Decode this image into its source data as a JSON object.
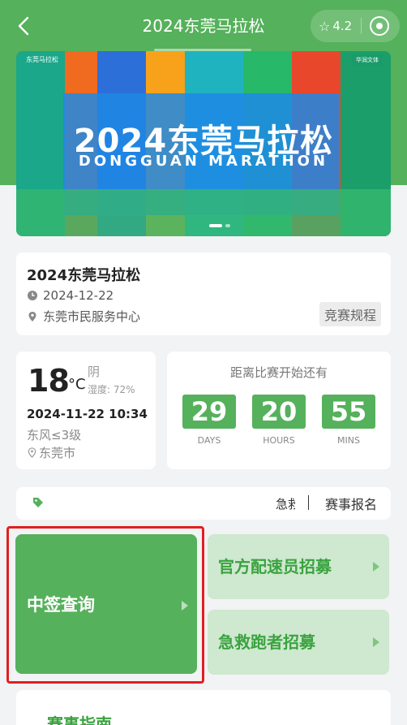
{
  "topbar": {
    "title": "2024东莞马拉松",
    "rating": "4.2"
  },
  "banner": {
    "title": "2024东莞马拉松",
    "subtitle": "DONGGUAN MARATHON",
    "logo_left": "东莞马拉松",
    "logo_right": "华润文体"
  },
  "event": {
    "name": "2024东莞马拉松",
    "date": "2024-12-22",
    "location": "东莞市民服务中心",
    "rules_label": "竞赛规程"
  },
  "weather": {
    "temp": "18",
    "unit": "°C",
    "condition": "阴",
    "humidity": "湿度: 72%",
    "datetime": "2024-11-22 10:34",
    "wind": "东风≤3级",
    "city": "东莞市"
  },
  "countdown": {
    "title": "距离比赛开始还有",
    "days": "29",
    "hours": "20",
    "mins": "55",
    "days_label": "DAYS",
    "hours_label": "HOURS",
    "mins_label": "MINS"
  },
  "notice": {
    "text": "急救",
    "register": "赛事报名"
  },
  "tiles": {
    "lottery": "中签查询",
    "pacer": "官方配速员招募",
    "firstaid": "急救跑者招募"
  },
  "guide": {
    "title": "赛事指南"
  },
  "colors": {
    "primary": "#55b15b",
    "highlight": "#e02020"
  }
}
